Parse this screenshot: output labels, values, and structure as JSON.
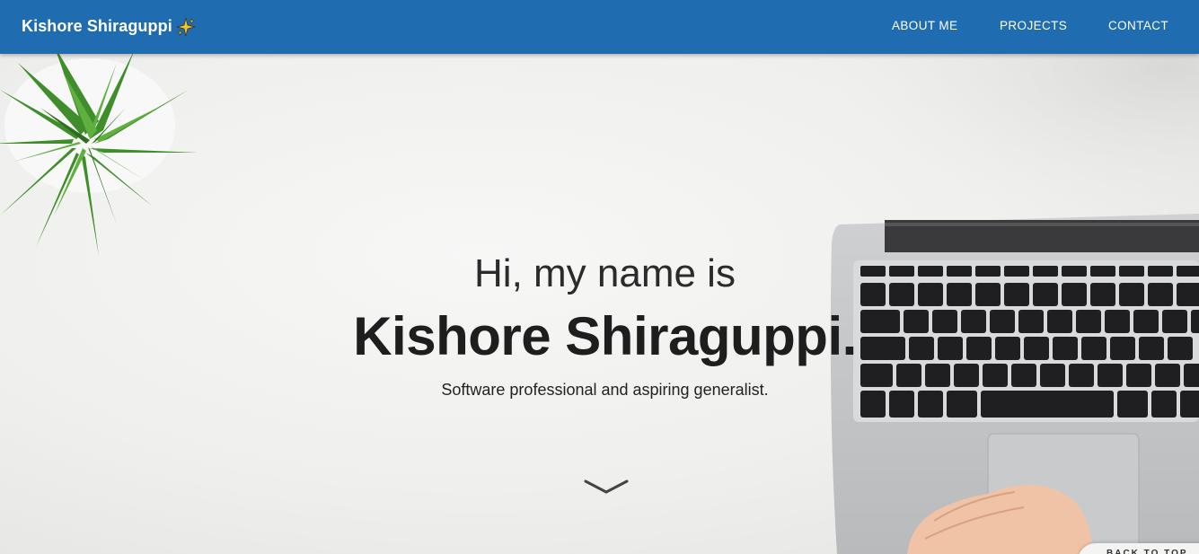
{
  "navbar": {
    "brand": "Kishore Shiraguppi",
    "links": [
      "ABOUT ME",
      "PROJECTS",
      "CONTACT"
    ]
  },
  "hero": {
    "greeting": "Hi, my name is",
    "name": "Kishore Shiraguppi.",
    "tagline": "Software professional and aspiring generalist.",
    "scroll_icon": "chevron-down-icon"
  },
  "back_to_top": "BACK TO TOP",
  "colors": {
    "navbar": "#1f6cb0",
    "background": "#efefed",
    "text": "#222222"
  }
}
